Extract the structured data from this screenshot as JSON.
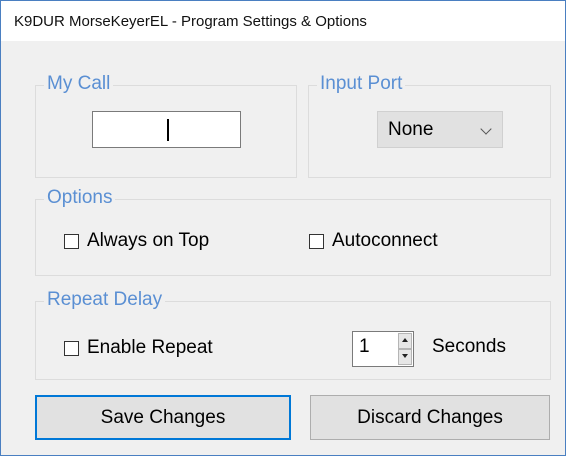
{
  "window": {
    "title": "K9DUR MorseKeyerEL - Program Settings & Options"
  },
  "my_call": {
    "legend": "My Call",
    "value": ""
  },
  "input_port": {
    "legend": "Input Port",
    "selected": "None"
  },
  "options": {
    "legend": "Options",
    "always_on_top": {
      "label": "Always on Top",
      "checked": false
    },
    "autoconnect": {
      "label": "Autoconnect",
      "checked": false
    }
  },
  "repeat_delay": {
    "legend": "Repeat Delay",
    "enable_repeat": {
      "label": "Enable Repeat",
      "checked": false
    },
    "seconds_value": "1",
    "seconds_label": "Seconds"
  },
  "buttons": {
    "save": "Save Changes",
    "discard": "Discard Changes"
  },
  "colors": {
    "legend_text": "#5a8fd3",
    "default_button_border": "#0078d7",
    "window_bg": "#f0f0f0"
  }
}
